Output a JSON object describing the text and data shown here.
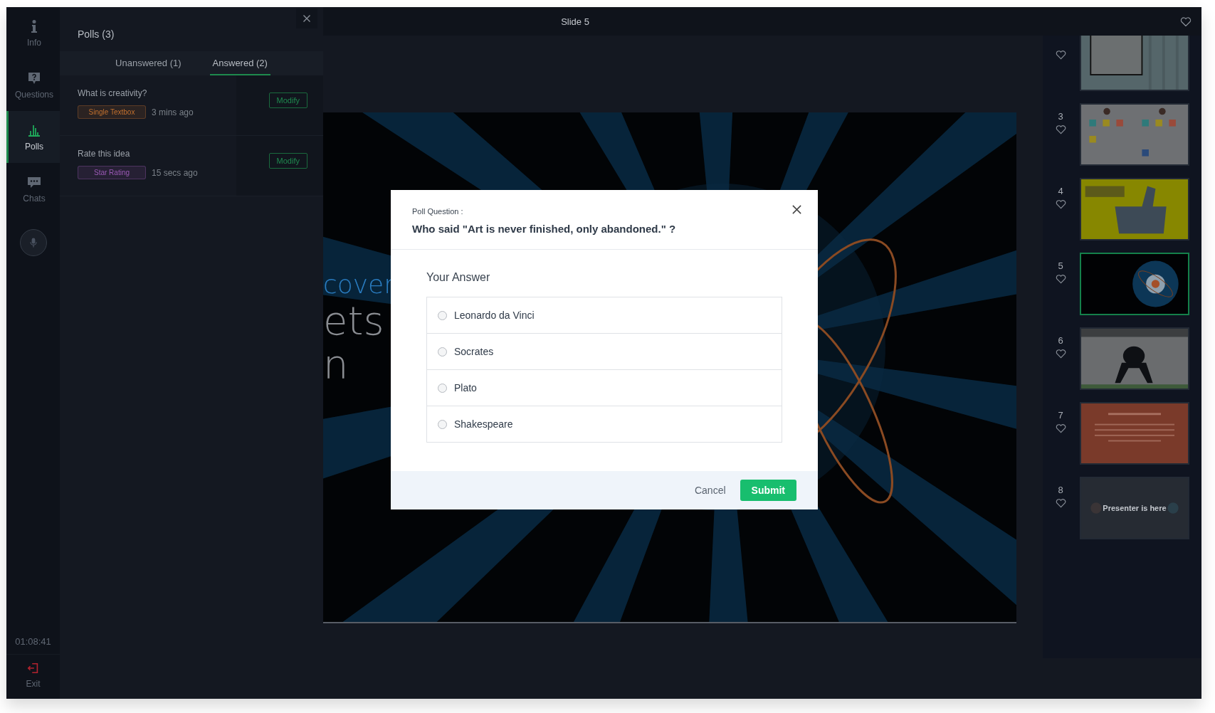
{
  "rail": {
    "items": [
      {
        "label": "Info",
        "kind": "info",
        "selected": false
      },
      {
        "label": "Questions",
        "kind": "question",
        "selected": false
      },
      {
        "label": "Polls",
        "kind": "chart",
        "selected": true
      },
      {
        "label": "Chats",
        "kind": "chat",
        "selected": false
      }
    ],
    "timer": "01:08:41",
    "exit": "Exit"
  },
  "polls_panel": {
    "title": "Polls (3)",
    "tabs": [
      {
        "label": "Unanswered (1)",
        "selected": false
      },
      {
        "label": "Answered (2)",
        "selected": true
      }
    ],
    "polls": [
      {
        "question": "What is creativity?",
        "type": "Single Textbox",
        "color": "#c2702e",
        "time": "3 mins ago",
        "action": "Modify"
      },
      {
        "question": "Rate this idea",
        "type": "Star Rating",
        "color": "#9b59b6",
        "time": "15 secs ago",
        "action": "Modify"
      }
    ]
  },
  "stage": {
    "title": "Slide 5",
    "slide_text": [
      "cover",
      "ets",
      "n"
    ]
  },
  "slides": [
    {
      "kind": "sign",
      "selected": false
    },
    {
      "number": "3",
      "kind": "grid",
      "selected": false
    },
    {
      "number": "4",
      "kind": "thumbs",
      "selected": false
    },
    {
      "number": "5",
      "kind": "atom",
      "selected": true
    },
    {
      "number": "6",
      "kind": "player",
      "selected": false
    },
    {
      "number": "7",
      "kind": "text",
      "selected": false
    },
    {
      "number": "8",
      "kind": "presenter",
      "selected": false,
      "overlay": "Presenter is here"
    }
  ],
  "modal": {
    "label": "Poll Question :",
    "question": "Who said \"Art is never finished, only abandoned.\" ?",
    "answer_label": "Your Answer",
    "options": [
      {
        "label": "Leonardo da Vinci",
        "selected": false
      },
      {
        "label": "Socrates",
        "selected": false
      },
      {
        "label": "Plato",
        "selected": false
      },
      {
        "label": "Shakespeare",
        "selected": false
      }
    ],
    "cancel": "Cancel",
    "submit": "Submit"
  }
}
